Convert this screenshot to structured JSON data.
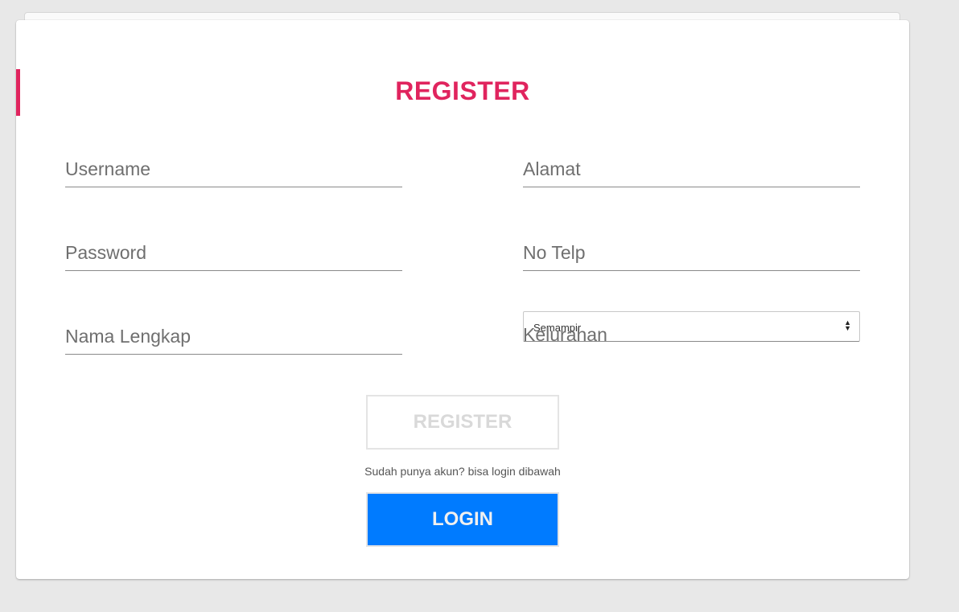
{
  "colors": {
    "accent": "#e0245e",
    "login_button": "#007bff"
  },
  "form": {
    "title": "REGISTER",
    "fields": {
      "username": "Username",
      "password": "Password",
      "nama_lengkap": "Nama Lengkap",
      "alamat": "Alamat",
      "no_telp": "No Telp",
      "kelurahan": "Kelurahan"
    },
    "kelurahan_select": {
      "selected": "Semampir",
      "icon": "sort-arrows-icon"
    },
    "register_button": "REGISTER",
    "login_hint": "Sudah punya akun? bisa login dibawah",
    "login_button": "LOGIN"
  }
}
